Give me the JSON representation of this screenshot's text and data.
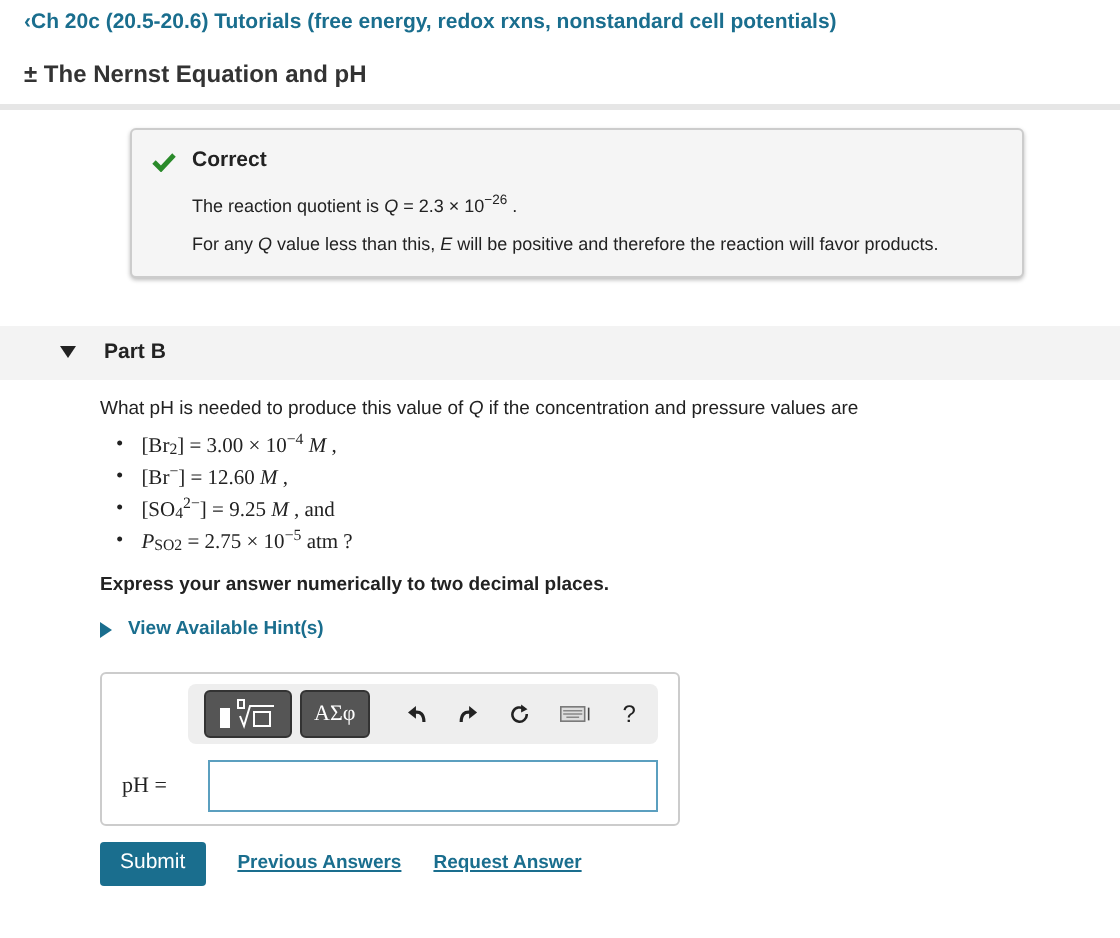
{
  "breadcrumb": {
    "icon": "‹",
    "text": "Ch 20c (20.5-20.6) Tutorials (free energy, redox rxns, nonstandard cell potentials)"
  },
  "title": {
    "icon": "±",
    "text": "The Nernst Equation and pH"
  },
  "feedback": {
    "status": "Correct",
    "correct": true,
    "lines": [
      "The reaction quotient is *Q* = 2.3 × 10$^{−26}$ .",
      "For any *Q* value less than this, *E* will be positive and therefore the reaction will favor products."
    ]
  },
  "part": {
    "label": "Part B",
    "expanded": true,
    "question": "What pH is needed to produce this value of *Q* if the concentration and pressure values are",
    "bullets": [
      {
        "marker": "•",
        "text": "[Br$_{2}$] = 3.00 × 10$^{−4}$ *M* ,"
      },
      {
        "marker": "•",
        "text": "[Br$^{−}$] = 12.60 *M* ,"
      },
      {
        "marker": "•",
        "text": "[SO$_{4}$$^{2−}$] = 9.25 *M* , and"
      },
      {
        "marker": "•",
        "text": "*P*$_{SO2}$ = 2.75 × 10$^{−5}$ atm ?"
      }
    ],
    "instruction": "Express your answer numerically to two decimal places.",
    "hints": {
      "label": "View Available Hint(s)",
      "expanded": false
    },
    "toolbar": {
      "symbols_label": "ΑΣφ",
      "help": "?"
    },
    "answer": {
      "label": "pH ="
    },
    "submit": "Submit",
    "links": [
      "Previous Answers",
      "Request Answer"
    ]
  }
}
